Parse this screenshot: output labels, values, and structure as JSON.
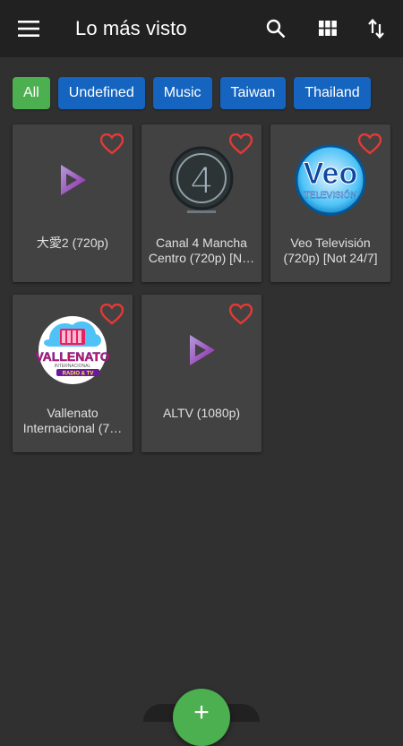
{
  "header": {
    "title": "Lo más visto",
    "icons": [
      "menu-icon",
      "search-icon",
      "grid-view-icon",
      "sort-icon"
    ]
  },
  "filters": [
    {
      "label": "All",
      "active": true
    },
    {
      "label": "Undefined",
      "active": false
    },
    {
      "label": "Music",
      "active": false
    },
    {
      "label": "Taiwan",
      "active": false
    },
    {
      "label": "Thailand",
      "active": false
    }
  ],
  "channels": [
    {
      "name": "大愛2 (720p)",
      "logo": "play-logo"
    },
    {
      "name": "Canal 4 Mancha Centro (720p) [N…",
      "logo": "canal4-logo"
    },
    {
      "name": "Veo Televisión (720p) [Not 24/7]",
      "logo": "veo-logo"
    },
    {
      "name": "Vallenato Internacional (7…",
      "logo": "vallenato-logo"
    },
    {
      "name": "ALTV (1080p)",
      "logo": "play-logo"
    }
  ],
  "fab": {
    "label": "+"
  },
  "colors": {
    "appbar": "#212121",
    "background": "#303030",
    "card": "#424242",
    "chip": "#1565c0",
    "chip_active": "#4caf50",
    "favorite": "#e53935",
    "fab": "#4caf50"
  }
}
